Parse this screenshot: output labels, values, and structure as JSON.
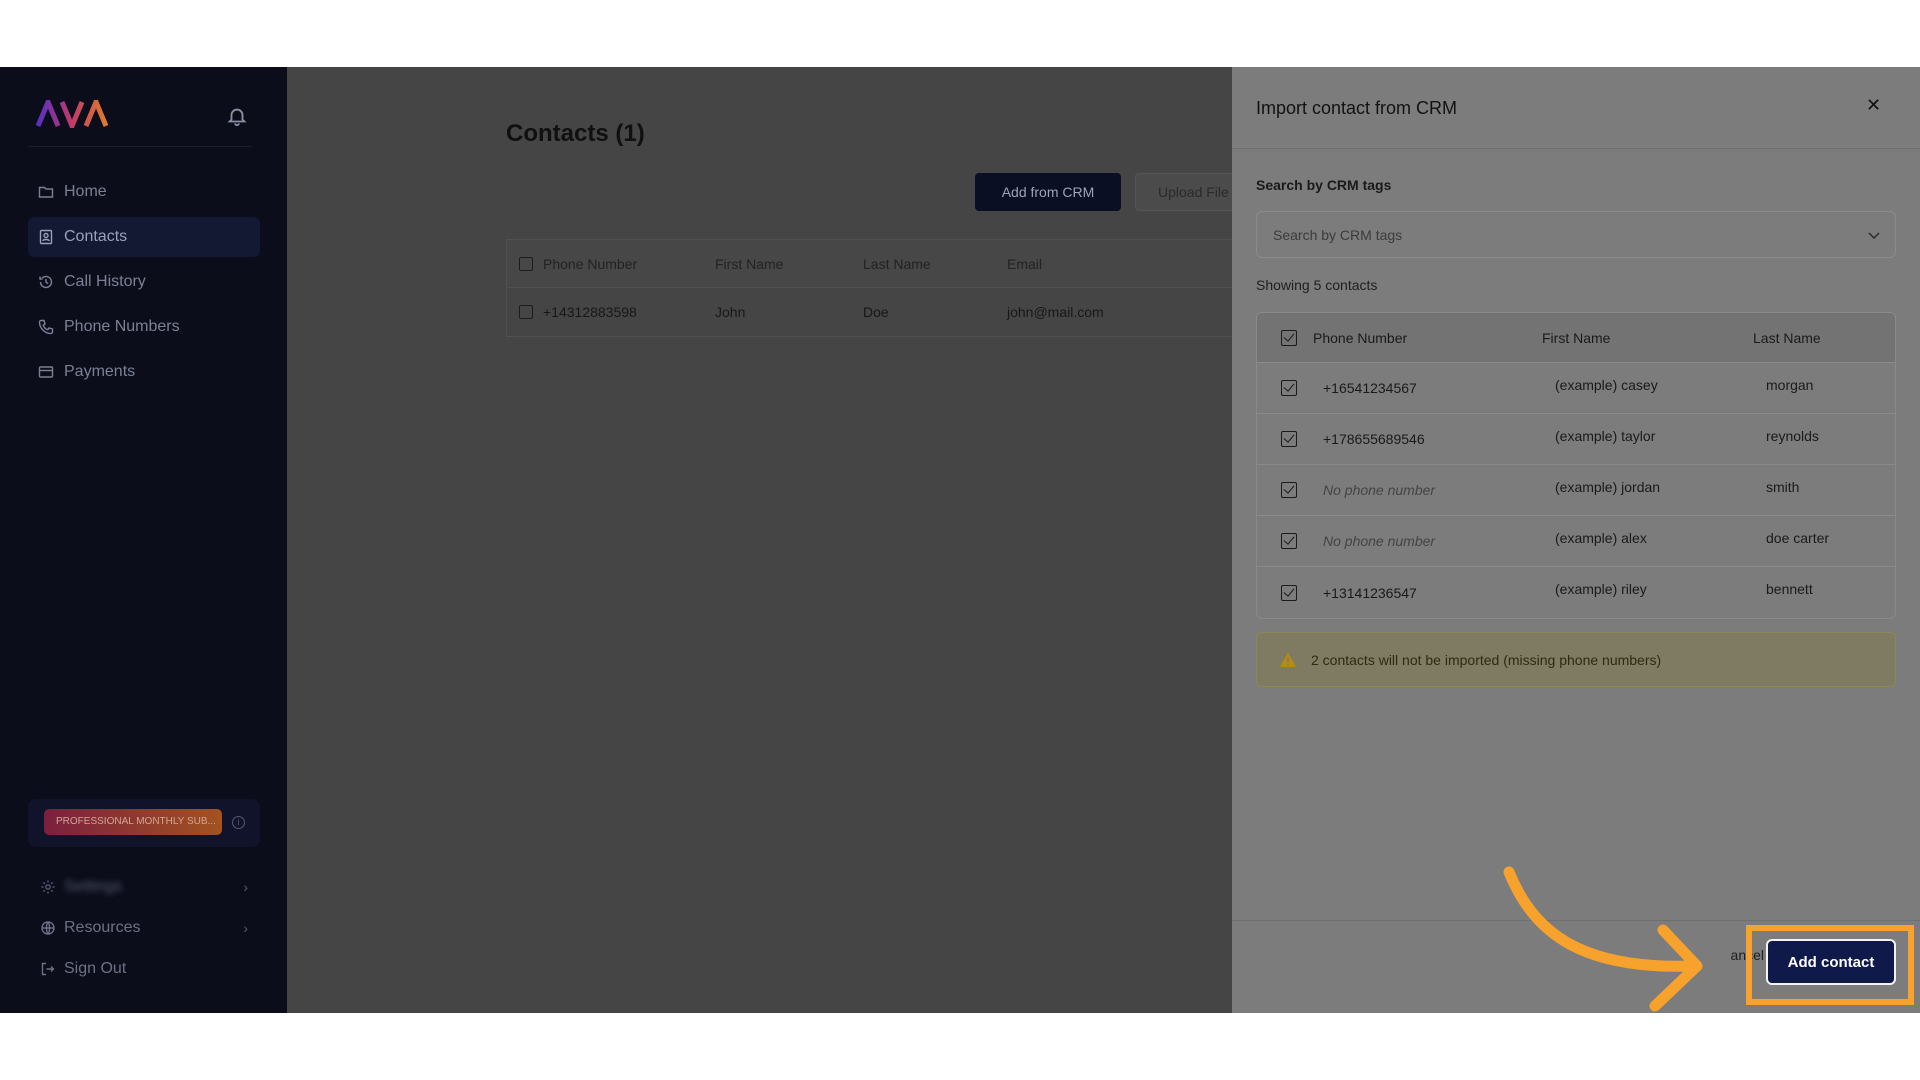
{
  "app": {
    "logo_text": "AVA"
  },
  "sidebar": {
    "items": [
      {
        "label": "Home",
        "icon": "folder-icon"
      },
      {
        "label": "Contacts",
        "icon": "contacts-icon",
        "active": true
      },
      {
        "label": "Call History",
        "icon": "history-icon"
      },
      {
        "label": "Phone Numbers",
        "icon": "phone-icon"
      },
      {
        "label": "Payments",
        "icon": "card-icon"
      }
    ],
    "plan_badge": "PROFESSIONAL MONTHLY SUB...",
    "settings_label": "Settings",
    "resources_label": "Resources",
    "signout_label": "Sign Out"
  },
  "main": {
    "title": "Contacts (1)",
    "add_from_crm": "Add from CRM",
    "upload_file": "Upload File",
    "table": {
      "headers": [
        "Phone Number",
        "First Name",
        "Last Name",
        "Email"
      ],
      "rows": [
        {
          "phone": "+14312883598",
          "first": "John",
          "last": "Doe",
          "email": "john@mail.com"
        }
      ]
    }
  },
  "dialog": {
    "title": "Import contact from CRM",
    "search_label": "Search by CRM tags",
    "search_placeholder": "Search by CRM tags",
    "showing": "Showing 5 contacts",
    "headers": {
      "phone": "Phone Number",
      "first": "First Name",
      "last": "Last Name"
    },
    "rows": [
      {
        "phone": "+16541234567",
        "first": "(example) casey",
        "last": "morgan",
        "checked": true
      },
      {
        "phone": "+178655689546",
        "first": "(example) taylor",
        "last": "reynolds",
        "checked": true
      },
      {
        "phone": "No phone number",
        "first": "(example) jordan",
        "last": "smith",
        "checked": true
      },
      {
        "phone": "No phone number",
        "first": "(example) alex",
        "last": "doe carter",
        "checked": true
      },
      {
        "phone": "+13141236547",
        "first": "(example) riley",
        "last": "bennett",
        "checked": true
      }
    ],
    "warning": "2 contacts will not be imported (missing phone numbers)",
    "cancel_label": "ancel",
    "add_label": "Add contact"
  },
  "colors": {
    "accent": "#f7a22c",
    "primary_button": "#101a4a",
    "sidebar_bg": "#0b0d1a"
  }
}
